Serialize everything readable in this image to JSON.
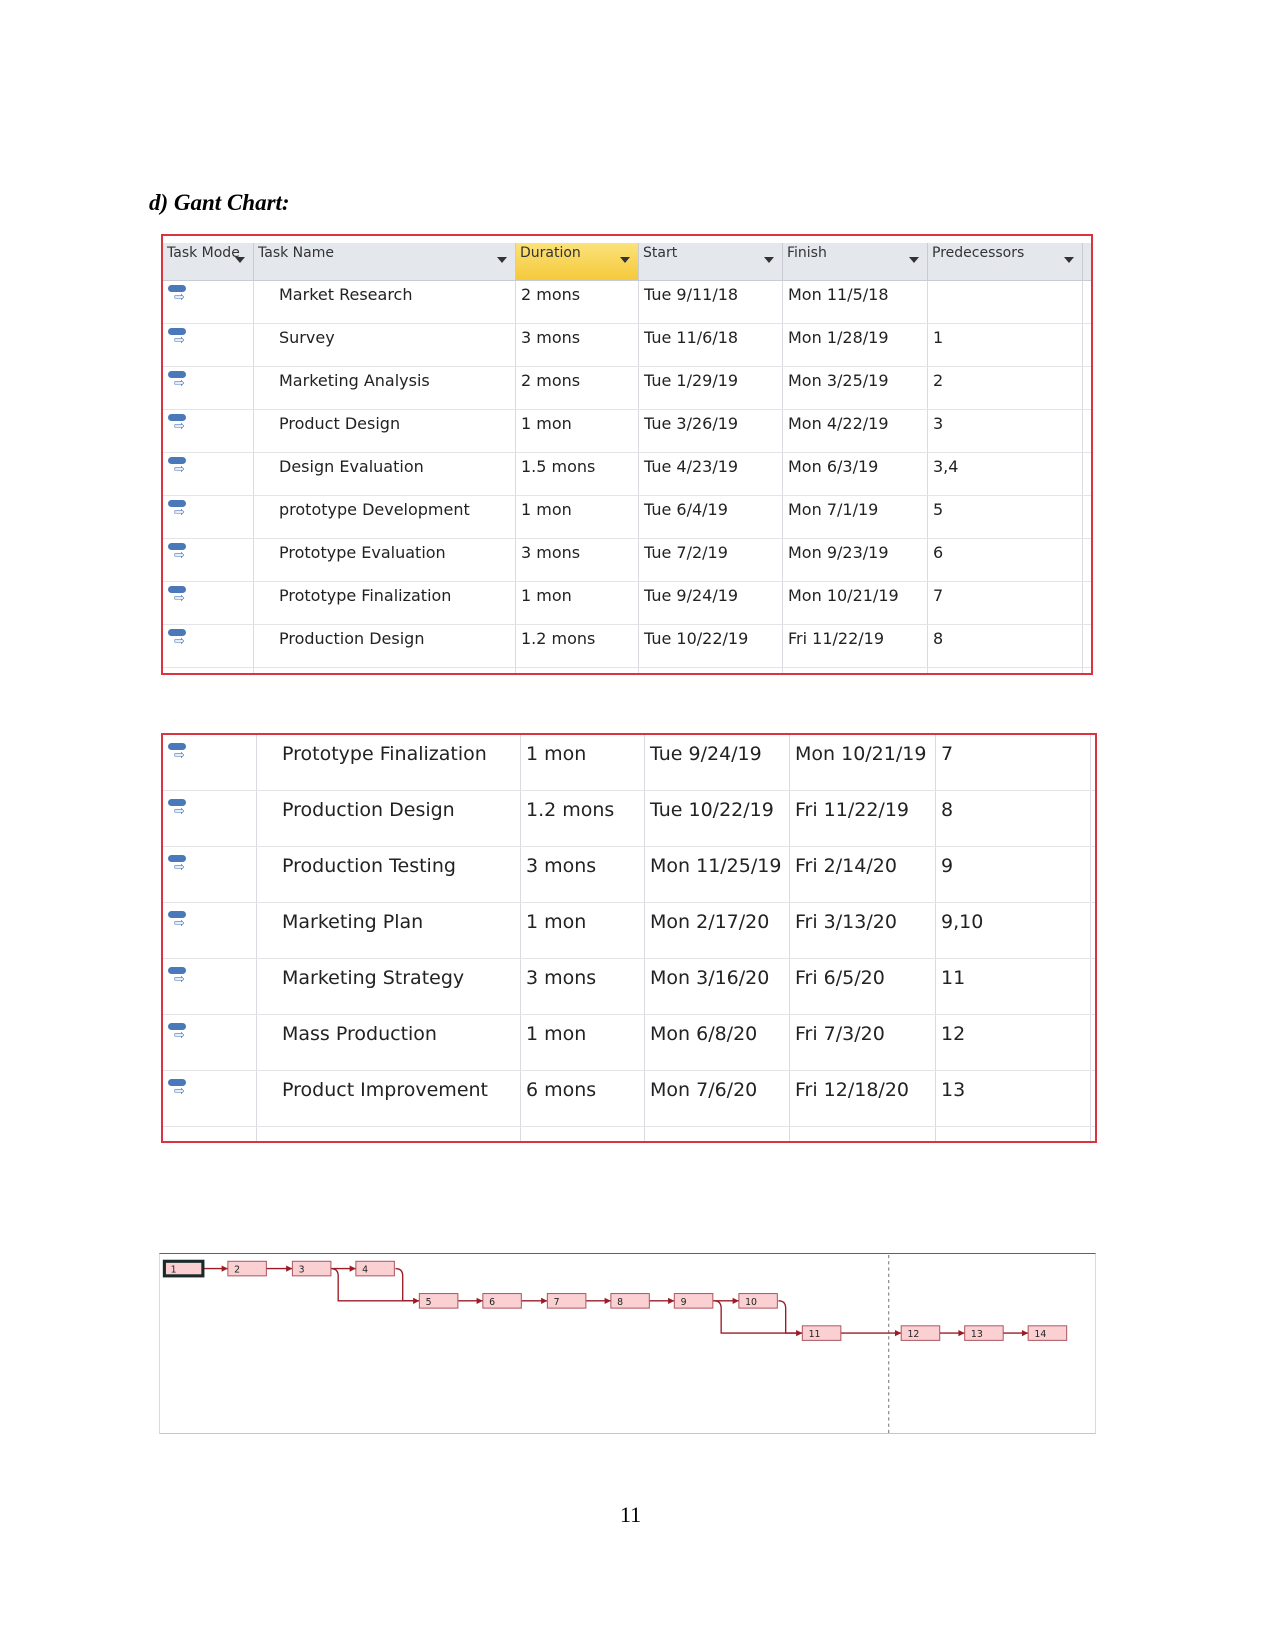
{
  "heading": "d) Gant Chart:",
  "table1": {
    "headers": [
      "Task Mode",
      "Task Name",
      "Duration",
      "Start",
      "Finish",
      "Predecessors"
    ],
    "highlighted_header": "Duration",
    "rows": [
      [
        "Market Research",
        "2 mons",
        "Tue 9/11/18",
        "Mon 11/5/18",
        ""
      ],
      [
        "Survey",
        "3 mons",
        "Tue 11/6/18",
        "Mon 1/28/19",
        "1"
      ],
      [
        "Marketing Analysis",
        "2 mons",
        "Tue 1/29/19",
        "Mon 3/25/19",
        "2"
      ],
      [
        "Product Design",
        "1 mon",
        "Tue 3/26/19",
        "Mon 4/22/19",
        "3"
      ],
      [
        "Design Evaluation",
        "1.5 mons",
        "Tue 4/23/19",
        "Mon 6/3/19",
        "3,4"
      ],
      [
        "prototype Development",
        "1 mon",
        "Tue 6/4/19",
        "Mon 7/1/19",
        "5"
      ],
      [
        "Prototype Evaluation",
        "3 mons",
        "Tue 7/2/19",
        "Mon 9/23/19",
        "6"
      ],
      [
        "Prototype Finalization",
        "1 mon",
        "Tue 9/24/19",
        "Mon 10/21/19",
        "7"
      ],
      [
        "Production Design",
        "1.2 mons",
        "Tue 10/22/19",
        "Fri 11/22/19",
        "8"
      ]
    ]
  },
  "table2": {
    "rows": [
      [
        "Prototype Finalization",
        "1 mon",
        "Tue 9/24/19",
        "Mon 10/21/19",
        "7"
      ],
      [
        "Production Design",
        "1.2 mons",
        "Tue 10/22/19",
        "Fri 11/22/19",
        "8"
      ],
      [
        "Production Testing",
        "3 mons",
        "Mon 11/25/19",
        "Fri 2/14/20",
        "9"
      ],
      [
        "Marketing Plan",
        "1 mon",
        "Mon 2/17/20",
        "Fri 3/13/20",
        "9,10"
      ],
      [
        "Marketing Strategy",
        "3 mons",
        "Mon 3/16/20",
        "Fri 6/5/20",
        "11"
      ],
      [
        "Mass Production",
        "1 mon",
        "Mon 6/8/20",
        "Fri 7/3/20",
        "12"
      ],
      [
        "Product Improvement",
        "6 mons",
        "Mon 7/6/20",
        "Fri 12/18/20",
        "13"
      ]
    ]
  },
  "network": {
    "nodes": [
      "1",
      "2",
      "3",
      "4",
      "5",
      "6",
      "7",
      "8",
      "9",
      "10",
      "11",
      "12",
      "13",
      "14"
    ],
    "colors": {
      "node_fill": "#fbd0d3",
      "node_border": "#b05a62",
      "link": "#9b1b25"
    }
  },
  "page_number": "11"
}
